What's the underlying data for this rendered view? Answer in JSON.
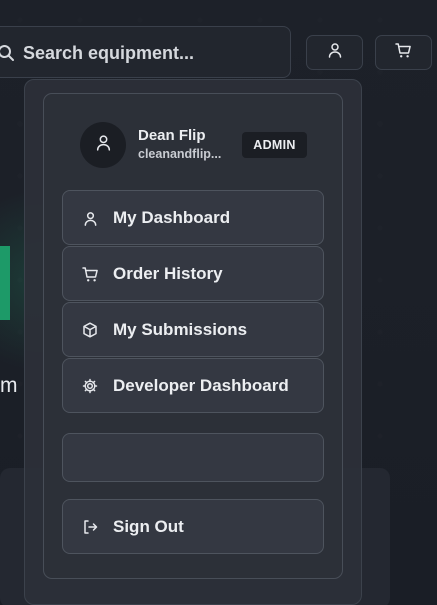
{
  "search": {
    "placeholder": "Search equipment..."
  },
  "header": {
    "account_icon": "user-icon",
    "cart_icon": "shopping-cart-icon"
  },
  "background": {
    "partial_text": "m"
  },
  "user": {
    "name": "Dean Flip",
    "email": "cleanandflip...",
    "role_badge": "ADMIN",
    "avatar_icon": "user-icon"
  },
  "menu": {
    "items": [
      {
        "label": "My Dashboard",
        "icon": "user-icon"
      },
      {
        "label": "Order History",
        "icon": "shopping-cart-icon"
      },
      {
        "label": "My Submissions",
        "icon": "package-icon"
      },
      {
        "label": "Developer Dashboard",
        "icon": "gear-icon"
      }
    ],
    "sign_out": {
      "label": "Sign Out",
      "icon": "log-out-icon"
    }
  },
  "colors": {
    "background": "#1b1f27",
    "panel": "#2c3038",
    "item": "#343842",
    "accent_green": "#1d9a68",
    "text": "#eceef1"
  }
}
